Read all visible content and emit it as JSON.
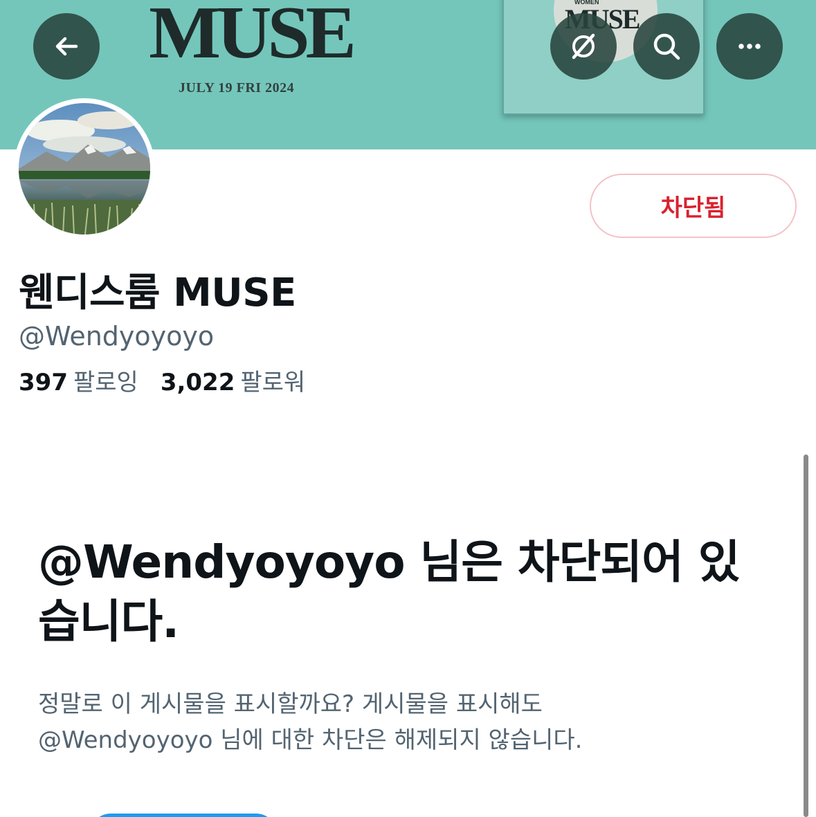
{
  "banner": {
    "title": "MUSE",
    "date": "JULY 19 FRI 2024",
    "album_title": "MUSE",
    "album_subtitle": "WOMEN",
    "background_color": "#74c6bb"
  },
  "top_bar": {
    "back_icon": "arrow-left-icon",
    "grok_icon": "grok-icon",
    "search_icon": "search-icon",
    "more_icon": "more-horizontal-icon"
  },
  "profile": {
    "display_name": "웬디스룸 MUSE",
    "handle": "@Wendyoyoyo",
    "following_count": "397",
    "following_label": "팔로잉",
    "followers_count": "3,022",
    "followers_label": "팔로워",
    "blocked_button_label": "차단됨",
    "blocked_color": "#d9222f"
  },
  "notice": {
    "heading": "@Wendyoyoyo 님은 차단되어 있습니다.",
    "body_line1": "정말로 이 게시물을 표시할까요? 게시물을 표시해도",
    "body_line2": "@Wendyoyoyo 님에 대한 차단은 해제되지 않습니다."
  },
  "accent_color": "#1d9bf0"
}
